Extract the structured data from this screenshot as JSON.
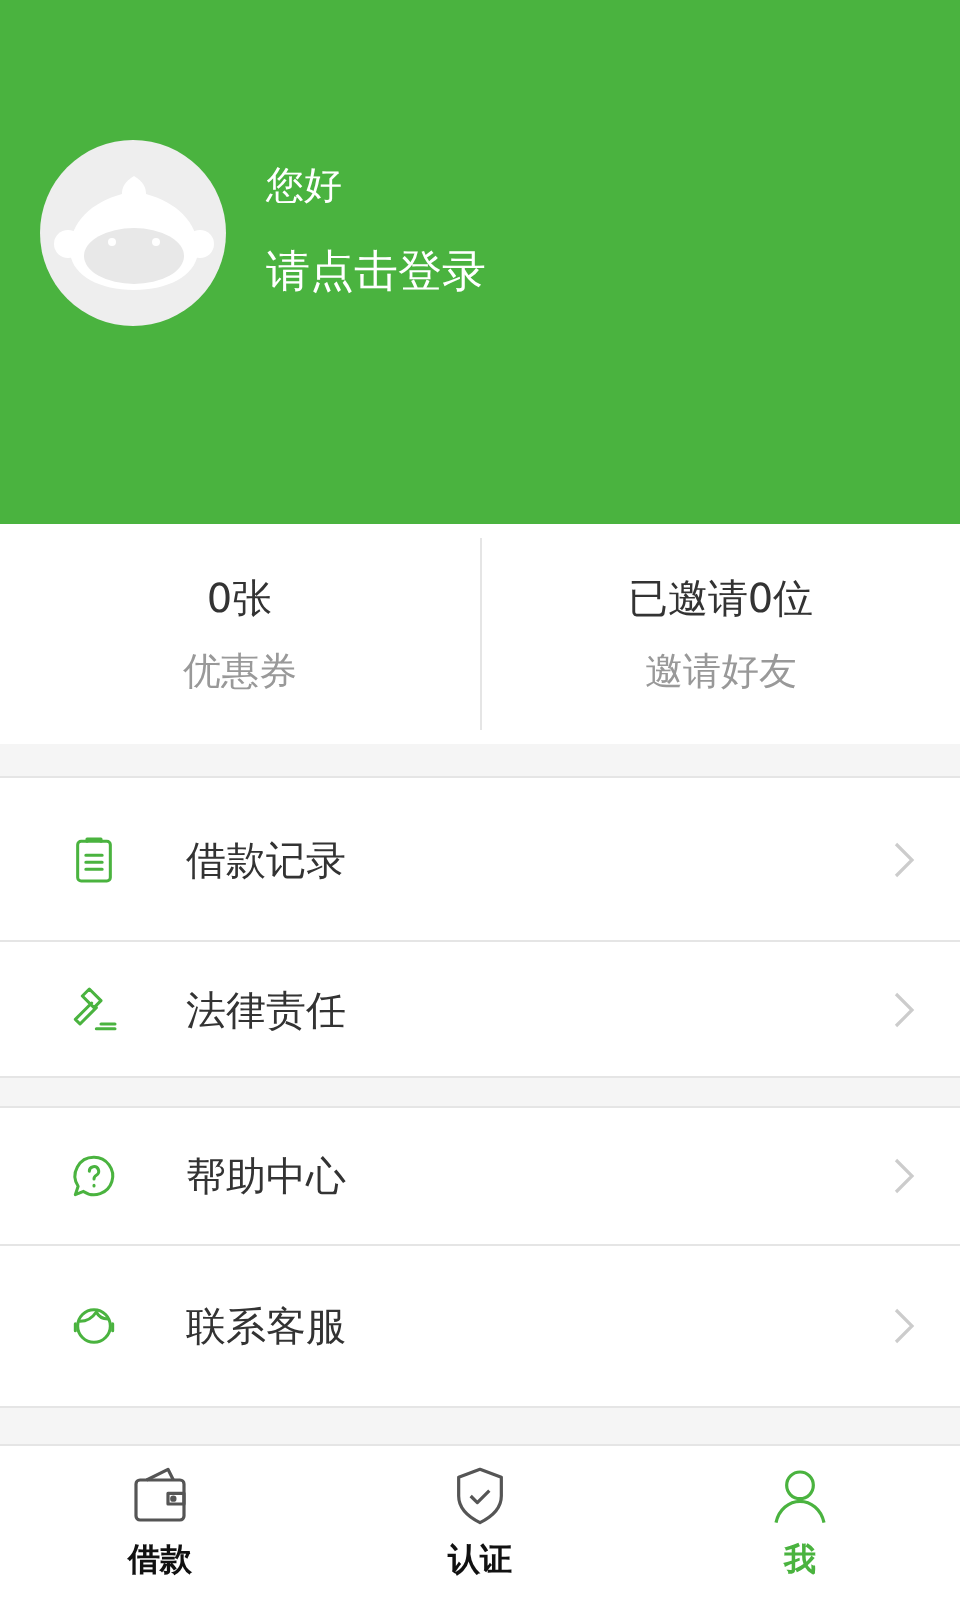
{
  "profile": {
    "greeting": "您好",
    "login_prompt": "请点击登录"
  },
  "stats": [
    {
      "value": "0张",
      "label": "优惠券"
    },
    {
      "value": "已邀请0位",
      "label": "邀请好友"
    }
  ],
  "menu_groups": [
    [
      {
        "kind": "clipboard",
        "label": "借款记录"
      },
      {
        "kind": "gavel",
        "label": "法律责任"
      }
    ],
    [
      {
        "kind": "help",
        "label": "帮助中心"
      },
      {
        "kind": "headset",
        "label": "联系客服"
      }
    ]
  ],
  "tabs": [
    {
      "kind": "wallet",
      "label": "借款",
      "selected": false
    },
    {
      "kind": "shield",
      "label": "认证",
      "selected": false
    },
    {
      "kind": "person",
      "label": "我",
      "selected": true
    }
  ]
}
